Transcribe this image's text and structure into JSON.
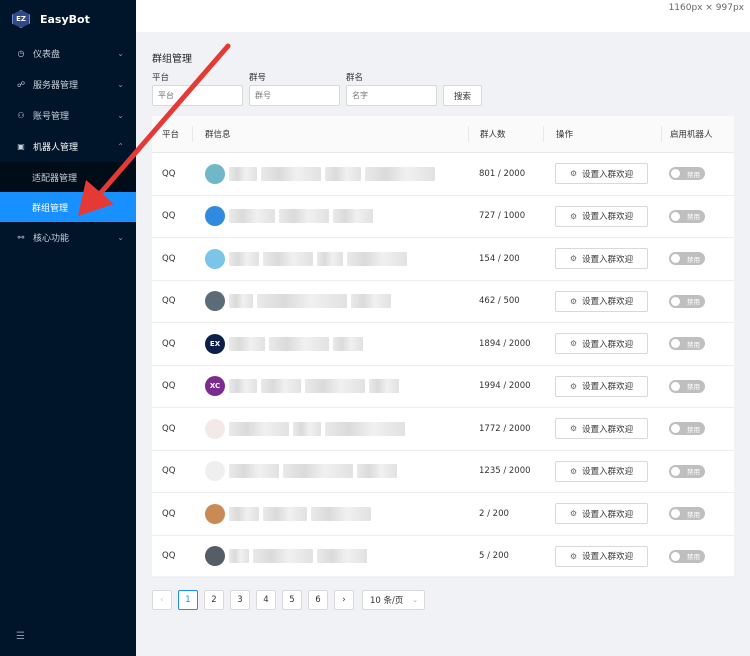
{
  "app": {
    "logo": "EZ",
    "name": "EasyBot"
  },
  "screenshot_size": "1160px × 997px",
  "sidebar": {
    "items": [
      {
        "label": "仪表盘",
        "icon": "dashboard-icon",
        "glyph": "◷",
        "chevron": "⌄"
      },
      {
        "label": "服务器管理",
        "icon": "server-icon",
        "glyph": "☍",
        "chevron": "⌄"
      },
      {
        "label": "账号管理",
        "icon": "account-icon",
        "glyph": "⚇",
        "chevron": "⌄"
      },
      {
        "label": "机器人管理",
        "icon": "robot-icon",
        "glyph": "▣",
        "chevron": "⌃"
      }
    ],
    "sub_items": [
      {
        "label": "适配器管理"
      },
      {
        "label": "群组管理"
      }
    ],
    "extra_item": {
      "label": "核心功能",
      "icon": "link-icon",
      "glyph": "⚯",
      "chevron": "⌄"
    },
    "collapse_glyph": "☰"
  },
  "page": {
    "title": "群组管理",
    "filters": {
      "platform_label": "平台",
      "platform_placeholder": "平台",
      "group_id_label": "群号",
      "group_id_placeholder": "群号",
      "group_name_label": "群名",
      "group_name_placeholder": "名字",
      "search_label": "搜索"
    },
    "table": {
      "columns": [
        "平台",
        "群信息",
        "群人数",
        "操作",
        "启用机器人"
      ],
      "op_label": "设置入群欢迎",
      "switch_label": "禁用",
      "rows": [
        {
          "platform": "QQ",
          "members": "801 / 2000",
          "avatar_color": "#6fb7c9",
          "avatar_text": ""
        },
        {
          "platform": "QQ",
          "members": "727 / 1000",
          "avatar_color": "#2f8ae0",
          "avatar_text": ""
        },
        {
          "platform": "QQ",
          "members": "154 / 200",
          "avatar_color": "#7cc4e8",
          "avatar_text": ""
        },
        {
          "platform": "QQ",
          "members": "462 / 500",
          "avatar_color": "#5b6b78",
          "avatar_text": ""
        },
        {
          "platform": "QQ",
          "members": "1894 / 2000",
          "avatar_color": "#0b1f4a",
          "avatar_text": "EX"
        },
        {
          "platform": "QQ",
          "members": "1994 / 2000",
          "avatar_color": "#7b2c8f",
          "avatar_text": "XC"
        },
        {
          "platform": "QQ",
          "members": "1772 / 2000",
          "avatar_color": "#f3e9e9",
          "avatar_text": ""
        },
        {
          "platform": "QQ",
          "members": "1235 / 2000",
          "avatar_color": "#efefef",
          "avatar_text": ""
        },
        {
          "platform": "QQ",
          "members": "2 / 200",
          "avatar_color": "#c98a55",
          "avatar_text": ""
        },
        {
          "platform": "QQ",
          "members": "5 / 200",
          "avatar_color": "#555d66",
          "avatar_text": ""
        }
      ]
    },
    "pagination": {
      "prev": "‹",
      "next": "›",
      "pages": [
        "1",
        "2",
        "3",
        "4",
        "5",
        "6"
      ],
      "current": "1",
      "page_size": "10 条/页"
    }
  },
  "colors": {
    "sidebar_bg": "#001529",
    "accent": "#1890ff",
    "arrow": "#e53935"
  }
}
